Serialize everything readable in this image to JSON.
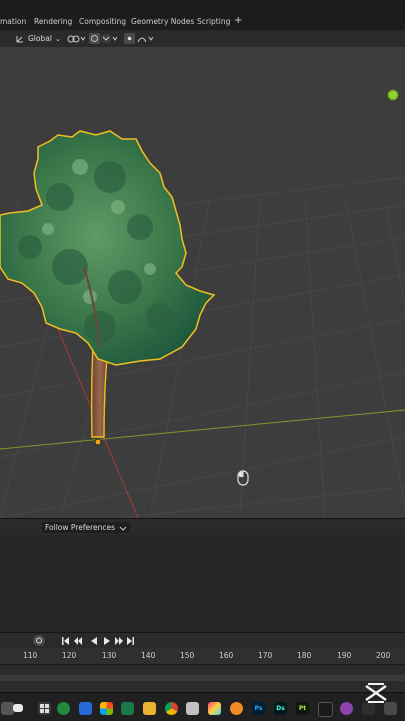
{
  "workspace_tabs": [
    "mation",
    "Rendering",
    "Compositing",
    "Geometry Nodes",
    "Scripting"
  ],
  "add_tab": "+",
  "viewport_header": {
    "transform_orientation": "Global",
    "transform_orientation_arrow": "⌄"
  },
  "timeline": {
    "dropdown_label": "Follow Preferences",
    "frame_ticks": [
      "110",
      "120",
      "130",
      "140",
      "150",
      "160",
      "170",
      "180",
      "190",
      "200"
    ]
  },
  "taskbar": {
    "photoshop_label": "Ps",
    "dimension_label": "Ds",
    "painter_label": "Pt"
  },
  "colors": {
    "viewport_bg": "#3d3d3d",
    "selection_outline": "#f0c020",
    "x_axis": "#a83a3a",
    "y_axis": "#7a9a2a",
    "foliage": "#3d7a4a",
    "trunk": "#8a5a3e"
  }
}
